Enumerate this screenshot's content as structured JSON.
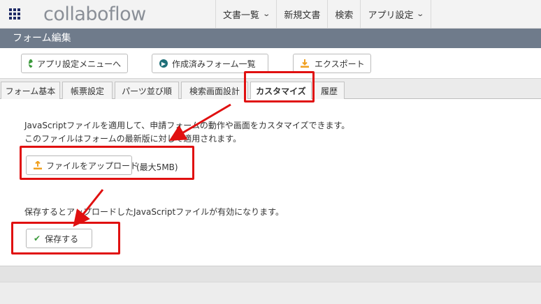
{
  "header": {
    "logo": "collaboflow",
    "nav": [
      {
        "label": "文書一覧",
        "has_menu": true
      },
      {
        "label": "新規文書",
        "has_menu": false
      },
      {
        "label": "検索",
        "has_menu": false
      },
      {
        "label": "アプリ設定",
        "has_menu": true
      }
    ]
  },
  "title_bar": {
    "title": "フォーム編集"
  },
  "toolbar": {
    "app_settings_menu": "アプリ設定メニューへ",
    "form_list": "作成済みフォーム一覧",
    "export": "エクスポート"
  },
  "tabs": [
    {
      "label": "フォーム基本",
      "active": false
    },
    {
      "label": "帳票設定",
      "active": false
    },
    {
      "label": "パーツ並び順",
      "active": false
    },
    {
      "label": "検索画面設計",
      "active": false
    },
    {
      "label": "カスタマイズ",
      "active": true
    },
    {
      "label": "履歴",
      "active": false
    }
  ],
  "content": {
    "description_line1": "JavaScriptファイルを適用して、申請フォームの動作や画面をカスタマイズできます。",
    "description_line2": "このファイルはフォームの最新版に対して適用されます。",
    "upload_button": "ファイルをアップロード",
    "upload_limit": "(最大5MB)",
    "save_note": "保存するとアップロードしたJavaScriptファイルが有効になります。",
    "save_button": "保存する"
  },
  "colors": {
    "title_bar": "#6f7b8b",
    "highlight": "#e01010",
    "icon_green": "#3c9a3c",
    "icon_teal": "#1f6f78",
    "icon_orange": "#f0a020",
    "grid_icon": "#1e2a66"
  },
  "icons": [
    "apps-grid-icon",
    "chevron-down-icon",
    "arrow-left-circle-icon",
    "arrow-right-circle-icon",
    "download-icon",
    "upload-icon",
    "check-icon"
  ]
}
